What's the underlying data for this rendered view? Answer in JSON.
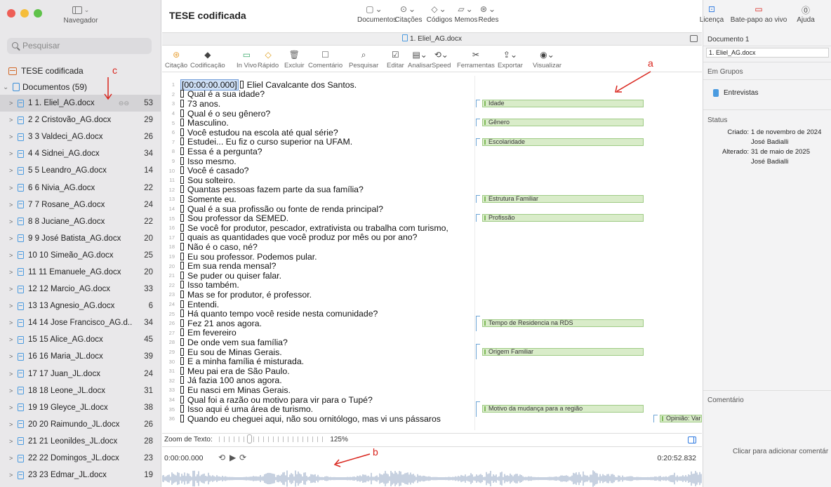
{
  "sidebar": {
    "toggle_label": "Navegador",
    "search_placeholder": "Pesquisar",
    "project": "TESE codificada",
    "documents_header": "Documentos (59)",
    "documents": [
      {
        "name": "1 1. Eliel_AG.docx",
        "count": "53"
      },
      {
        "name": "2 2 Cristovão_AG.docx",
        "count": "29"
      },
      {
        "name": "3 3 Valdeci_AG.docx",
        "count": "26"
      },
      {
        "name": "4 4 Sidnei_AG.docx",
        "count": "34"
      },
      {
        "name": "5 5 Leandro_AG.docx",
        "count": "14"
      },
      {
        "name": "6 6 Nivia_AG.docx",
        "count": "22"
      },
      {
        "name": "7 7 Rosane_AG.docx",
        "count": "24"
      },
      {
        "name": "8 8 Juciane_AG.docx",
        "count": "22"
      },
      {
        "name": "9 9 José Batista_AG.docx",
        "count": "20"
      },
      {
        "name": "10 10 Simeão_AG.docx",
        "count": "25"
      },
      {
        "name": "11 11 Emanuele_AG.docx",
        "count": "20"
      },
      {
        "name": "12 12 Marcio_AG.docx",
        "count": "33"
      },
      {
        "name": "13 13 Agnesio_AG.docx",
        "count": "6"
      },
      {
        "name": "14 14 Jose Francisco_AG.d...",
        "count": "34"
      },
      {
        "name": "15 15 Alice_AG.docx",
        "count": "45"
      },
      {
        "name": "16 16 Maria_JL.docx",
        "count": "39"
      },
      {
        "name": "17 17 Juan_JL.docx",
        "count": "24"
      },
      {
        "name": "18 18 Leone_JL.docx",
        "count": "31"
      },
      {
        "name": "19 19 Gleyce_JL.docx",
        "count": "38"
      },
      {
        "name": "20 20 Raimundo_JL.docx",
        "count": "26"
      },
      {
        "name": "21 21 Leonildes_JL.docx",
        "count": "28"
      },
      {
        "name": "22 22 Domingos_JL.docx",
        "count": "23"
      },
      {
        "name": "23 23 Edmar_JL.docx",
        "count": "19"
      }
    ]
  },
  "header": {
    "title": "TESE codificada",
    "menu": [
      "Documentos",
      "Citações",
      "Códigos",
      "Memos",
      "Redes"
    ],
    "right_menu": [
      "Licença",
      "Bate-papo ao vivo",
      "Ajuda"
    ]
  },
  "tab": {
    "label": "1. Eliel_AG.docx"
  },
  "toolbar": [
    "Citação",
    "Codificação",
    "In Vivo",
    "Rápido",
    "Excluir",
    "Comentário",
    "Pesquisar",
    "Editar",
    "Analisar",
    "Speed",
    "Ferramentas",
    "Exportar",
    "Visualizar"
  ],
  "editor": {
    "timestamp": "[00:00:00.000]",
    "lines": [
      "Eliel Cavalcante dos Santos.",
      "Qual é a sua idade?",
      "73 anos.",
      "Qual é o seu gênero?",
      "Masculino.",
      "Você estudou na escola até qual série?",
      "Estudei... Eu fiz o curso superior na UFAM.",
      "Essa é a pergunta?",
      "Isso mesmo.",
      "Você é casado?",
      "Sou solteiro.",
      "Quantas pessoas fazem parte da sua família?",
      "Somente eu.",
      "Qual é a sua profissão ou fonte de renda principal?",
      "Sou professor da SEMED.",
      "Se você for produtor, pescador, extrativista ou trabalha com turismo,",
      "quais as quantidades que você produz por mês ou por ano?",
      "Não é o caso, né?",
      "Eu sou professor. Podemos pular.",
      "Em sua renda mensal?",
      "Se puder ou quiser falar.",
      "Isso também.",
      "Mas se for produtor, é professor.",
      "Entendi.",
      "Há quanto tempo você reside nesta comunidade?",
      "Fez 21 anos agora.",
      "Em fevereiro",
      "De onde vem sua família?",
      "Eu sou de Minas Gerais.",
      "E a minha família é misturada.",
      "Meu pai era de São Paulo.",
      "Já fazia 100 anos agora.",
      "Eu nasci em Minas Gerais.",
      "Qual foi a razão ou motivo para vir para o Tupé?",
      "Isso aqui é uma área de turismo.",
      "Quando eu cheguei aqui, não sou ornitólogo, mas vi uns pássaros"
    ],
    "codes": [
      {
        "label": "Idade",
        "line": 3
      },
      {
        "label": "Gênero",
        "line": 5
      },
      {
        "label": "Escolaridade",
        "line": 7
      },
      {
        "label": "Estrutura Familiar",
        "line": 13
      },
      {
        "label": "Profissão",
        "line": 15
      },
      {
        "label": "Tempo de Residencia na RDS",
        "line": 26,
        "tag": "1:11"
      },
      {
        "label": "Origem Familiar",
        "line": 29,
        "tag": "1:13"
      },
      {
        "label": "Motivo da mudança para a região",
        "line": 35,
        "tag": "1:14"
      }
    ],
    "extra_code": "Opinião: Var"
  },
  "zoom": {
    "label": "Zoom de Texto:",
    "value": "125%",
    "fraction": 0.27
  },
  "media": {
    "start": "0:00:00.000",
    "end": "0:20:52.832"
  },
  "inspector": {
    "header": "Documento 1",
    "name_value": "1. Eliel_AG.docx",
    "groups_title": "Em Grupos",
    "group": "Entrevistas",
    "status_title": "Status",
    "created_label": "Criado:",
    "created_value": "1 de novembro de 2024",
    "created_by": "José Badialli",
    "modified_label": "Alterado:",
    "modified_value": "31 de maio de 2025",
    "modified_by": "José Badialli",
    "comment_title": "Comentário",
    "comment_hint": "Clicar para adicionar comentár"
  },
  "annotations": {
    "a": "a",
    "b": "b",
    "c": "c"
  },
  "colors": {
    "accent": "#2f7ae0",
    "code_green": "#d9ecc9",
    "annotation": "#d9251d"
  }
}
